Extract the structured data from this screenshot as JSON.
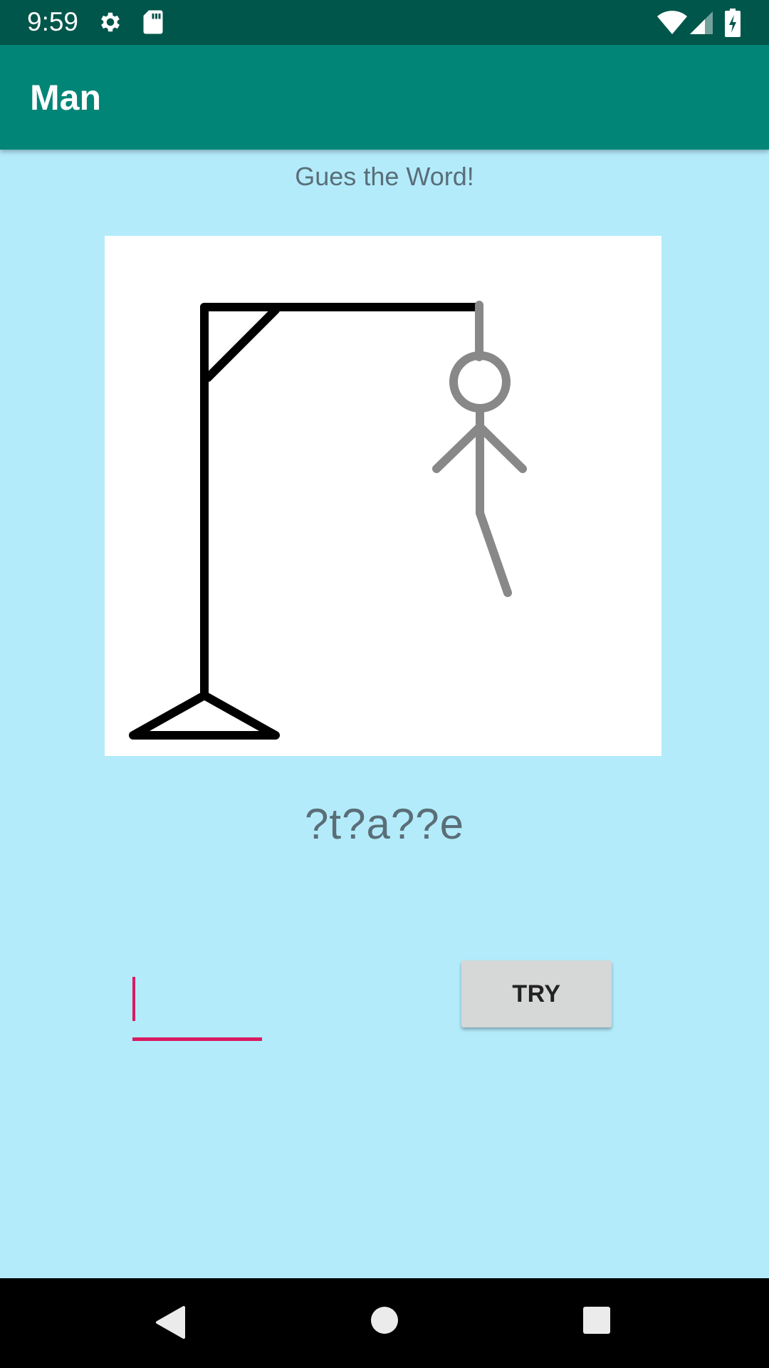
{
  "status_bar": {
    "time": "9:59",
    "icons": [
      "gear-icon",
      "sd-card-icon",
      "wifi-icon",
      "signal-icon",
      "battery-charging-icon"
    ]
  },
  "app_bar": {
    "title": "Man"
  },
  "game": {
    "prompt": "Gues the Word!",
    "masked_word": "?t?a??e",
    "guess_input": {
      "value": "",
      "placeholder": ""
    },
    "try_label": "TRY"
  },
  "nav_bar": {
    "icons": [
      "back-icon",
      "home-icon",
      "recents-icon"
    ]
  },
  "colors": {
    "status_bar": "#00564b",
    "app_bar": "#008577",
    "background": "#b3ebfb",
    "accent": "#d81b60",
    "button": "#d6d7d7",
    "text_muted": "#5a6e77"
  }
}
